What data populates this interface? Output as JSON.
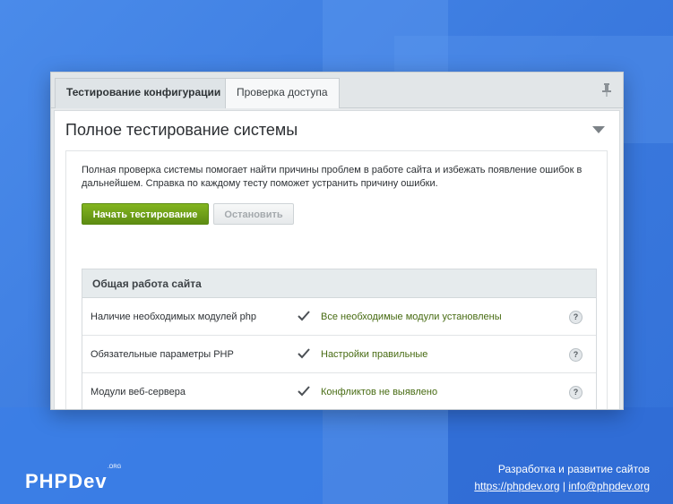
{
  "window": {
    "tabs": [
      {
        "label": "Тестирование конфигурации",
        "active": true
      },
      {
        "label": "Проверка доступа",
        "active": false
      }
    ]
  },
  "main": {
    "title": "Полное тестирование системы",
    "description": "Полная проверка системы помогает найти причины проблем в работе сайта и избежать появление ошибок в дальнейшем. Справка по каждому тесту поможет устранить причину ошибки.",
    "start_button": "Начать тестирование",
    "stop_button": "Остановить",
    "table": {
      "header": "Общая работа сайта",
      "rows": [
        {
          "name": "Наличие необходимых модулей php",
          "result": "Все необходимые модули установлены",
          "help": "?"
        },
        {
          "name": "Обязательные параметры PHP",
          "result": "Настройки правильные",
          "help": "?"
        },
        {
          "name": "Модули веб-сервера",
          "result": "Конфликтов не выявлено",
          "help": "?"
        }
      ]
    }
  },
  "footer": {
    "logo": "PHPDev",
    "logo_sup": ".ORG",
    "tagline": "Разработка и развитие сайтов",
    "site_link": "https://phpdev.org",
    "separator": "|",
    "email_link": "info@phpdev.org"
  },
  "colors": {
    "accent_green": "#6f9f19",
    "result_text": "#476b12",
    "background_blue": "#3f7fe0"
  },
  "icons": {
    "pin": "pin-icon",
    "collapse": "triangle-down-icon",
    "check": "checkmark-icon",
    "help": "help-circle-icon"
  }
}
